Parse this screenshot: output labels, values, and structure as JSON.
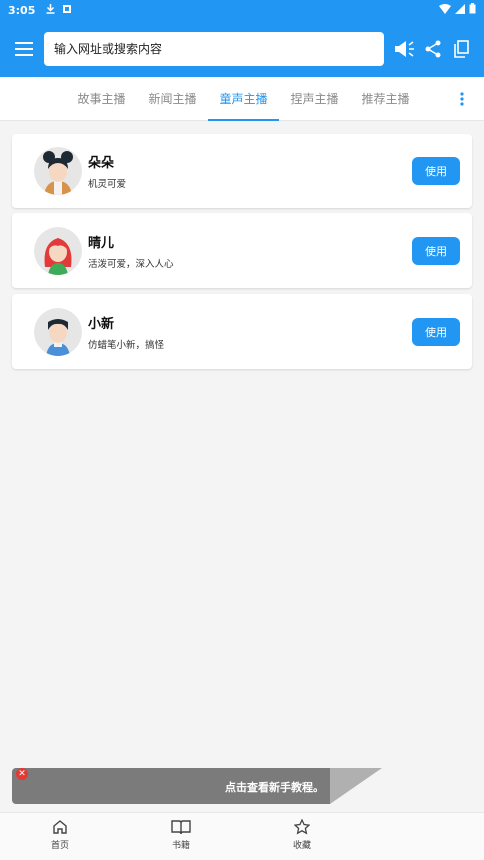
{
  "status_bar": {
    "time": "3:05"
  },
  "toolbar": {
    "search_placeholder": "输入网址或搜索内容"
  },
  "tabs": [
    {
      "label": "故事主播",
      "active": false
    },
    {
      "label": "新闻主播",
      "active": false
    },
    {
      "label": "童声主播",
      "active": true
    },
    {
      "label": "捏声主播",
      "active": false
    },
    {
      "label": "推荐主播",
      "active": false
    }
  ],
  "anchors": [
    {
      "name": "朵朵",
      "desc": "机灵可爱",
      "button": "使用",
      "avatar": "girl-bun-avatar"
    },
    {
      "name": "晴儿",
      "desc": "活泼可爱，深入人心",
      "button": "使用",
      "avatar": "girl-red-hair-avatar"
    },
    {
      "name": "小新",
      "desc": "仿蜡笔小新，搞怪",
      "button": "使用",
      "avatar": "boy-avatar"
    }
  ],
  "toast": {
    "message": "点击查看新手教程。"
  },
  "bottom_nav": [
    {
      "label": "首页",
      "icon": "home-icon"
    },
    {
      "label": "书籍",
      "icon": "book-icon"
    },
    {
      "label": "收藏",
      "icon": "star-icon"
    }
  ],
  "colors": {
    "primary": "#2196f3",
    "close_badge": "#e53935"
  }
}
